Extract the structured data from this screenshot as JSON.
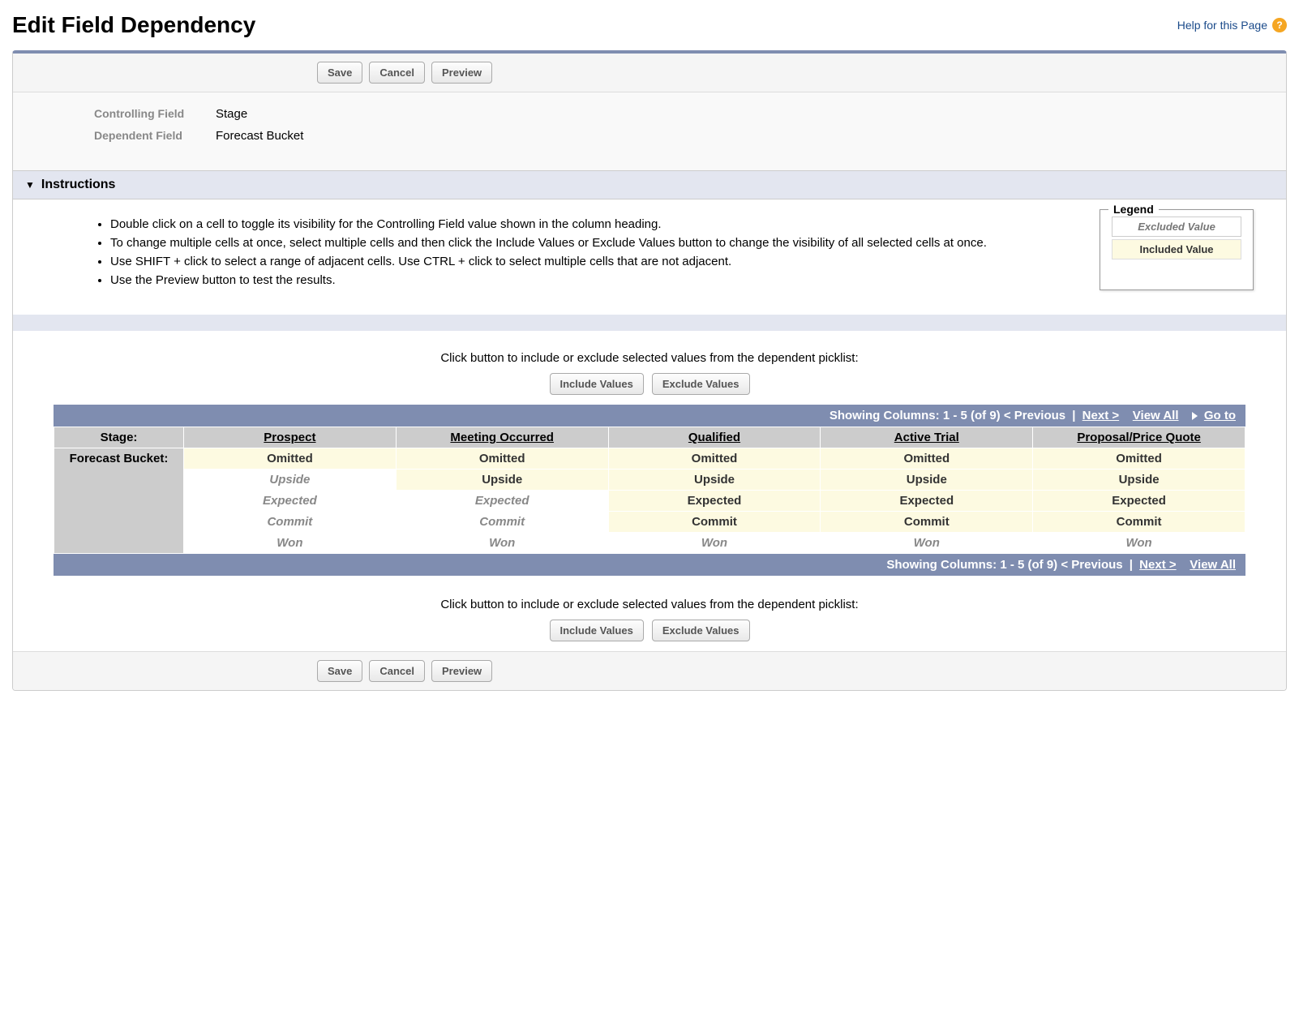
{
  "page_title": "Edit Field Dependency",
  "help_link": "Help for this Page",
  "buttons": {
    "save": "Save",
    "cancel": "Cancel",
    "preview": "Preview",
    "include_values": "Include Values",
    "exclude_values": "Exclude Values"
  },
  "controlling_field_label": "Controlling Field",
  "controlling_field_value": "Stage",
  "dependent_field_label": "Dependent Field",
  "dependent_field_value": "Forecast Bucket",
  "instructions_title": "Instructions",
  "instructions": [
    "Double click on a cell to toggle its visibility for the Controlling Field value shown in the column heading.",
    "To change multiple cells at once, select multiple cells and then click the Include Values or Exclude Values button to change the visibility of all selected cells at once.",
    "Use SHIFT + click to select a range of adjacent cells. Use CTRL + click to select multiple cells that are not adjacent.",
    "Use the Preview button to test the results."
  ],
  "legend": {
    "title": "Legend",
    "excluded": "Excluded Value",
    "included": "Included Value"
  },
  "include_exclude_prompt": "Click button to include or exclude selected values from the dependent picklist:",
  "pagination": {
    "top_label": "Showing Columns: 1 - 5 (of 9)",
    "previous": "< Previous",
    "next": "Next >",
    "view_all": "View All",
    "go_to": "Go to",
    "bottom_label": "Showing Columns: 1 - 5 (of 9)"
  },
  "grid": {
    "row_header_controlling": "Stage:",
    "row_header_dependent": "Forecast Bucket:",
    "columns": [
      "Prospect",
      "Meeting Occurred",
      "Qualified",
      "Active Trial",
      "Proposal/Price Quote"
    ],
    "rows": [
      {
        "label": "Omitted",
        "included": [
          true,
          true,
          true,
          true,
          true
        ]
      },
      {
        "label": "Upside",
        "included": [
          false,
          true,
          true,
          true,
          true
        ]
      },
      {
        "label": "Expected",
        "included": [
          false,
          false,
          true,
          true,
          true
        ]
      },
      {
        "label": "Commit",
        "included": [
          false,
          false,
          true,
          true,
          true
        ]
      },
      {
        "label": "Won",
        "included": [
          false,
          false,
          false,
          false,
          false
        ]
      }
    ]
  }
}
